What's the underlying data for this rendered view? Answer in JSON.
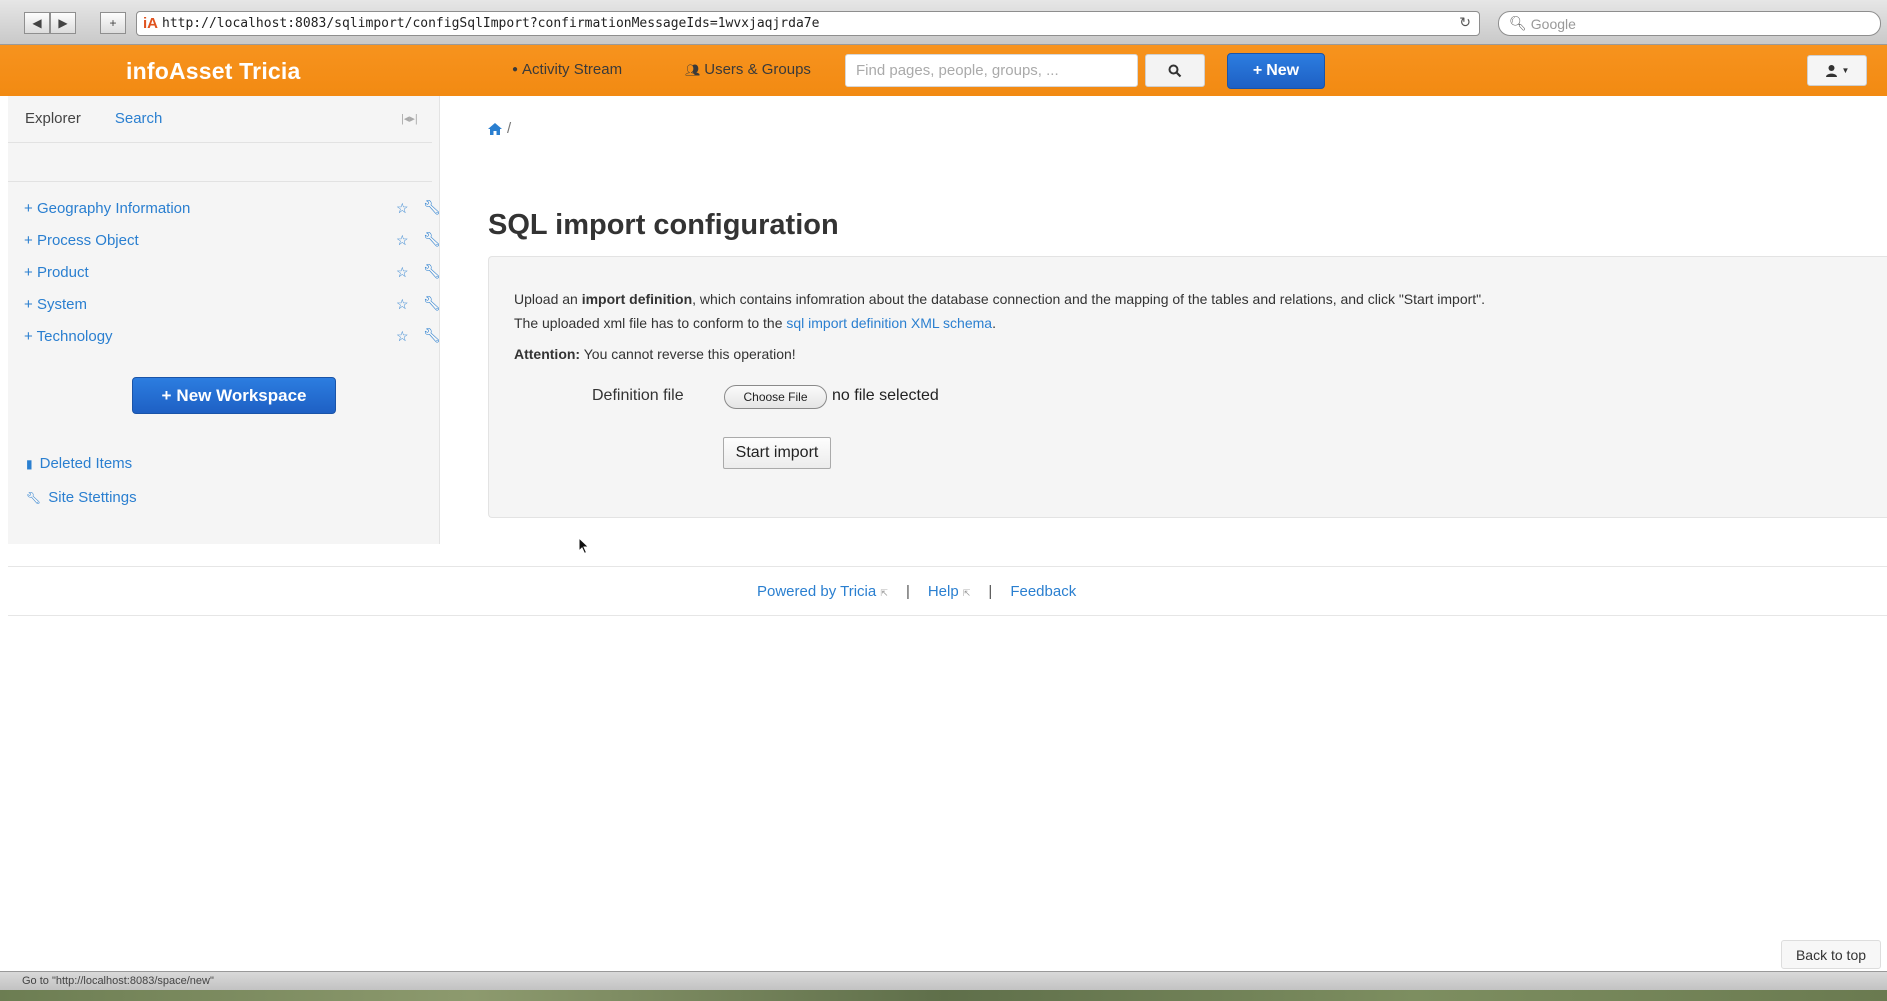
{
  "browser": {
    "url": "http://localhost:8083/sqlimport/configSqlImport?confirmationMessageIds=1wvxjaqjrda7e",
    "favicon_text": "iA",
    "search_placeholder": "Google"
  },
  "header": {
    "brand": "infoAsset Tricia",
    "activity_stream": "Activity Stream",
    "users_groups": "Users & Groups",
    "search_placeholder": "Find pages, people, groups, ...",
    "new_label": "New"
  },
  "sidebar": {
    "tab_explorer": "Explorer",
    "tab_search": "Search",
    "tree": [
      {
        "label": "Geography Information"
      },
      {
        "label": "Process Object"
      },
      {
        "label": "Product"
      },
      {
        "label": "System"
      },
      {
        "label": "Technology"
      }
    ],
    "new_workspace": "New Workspace",
    "deleted_items": "Deleted Items",
    "site_settings": "Site Stettings"
  },
  "main": {
    "breadcrumb_sep": "/",
    "title": "SQL import configuration",
    "text1_a": "Upload an ",
    "text1_b": "import definition",
    "text1_c": ", which contains infomration about the database connection and the mapping of the tables and relations, and click \"Start import\".",
    "text2_a": "The uploaded xml file has to conform to the ",
    "text2_link": "sql import definition XML schema",
    "text2_c": ".",
    "attention_label": "Attention:",
    "attention_text": " You cannot reverse this operation!",
    "definition_label": "Definition file",
    "choose_file": "Choose File",
    "no_file": "no file selected",
    "start_import": "Start import"
  },
  "footer": {
    "powered_by": "Powered by Tricia",
    "help": "Help",
    "feedback": "Feedback",
    "separator": "|"
  },
  "back_to_top": "Back to top",
  "status_bar": "Go to \"http://localhost:8083/space/new\"",
  "colors": {
    "header_orange": "#f7931e",
    "link_blue": "#2a7fd0",
    "primary_button": "#1e60c4"
  }
}
